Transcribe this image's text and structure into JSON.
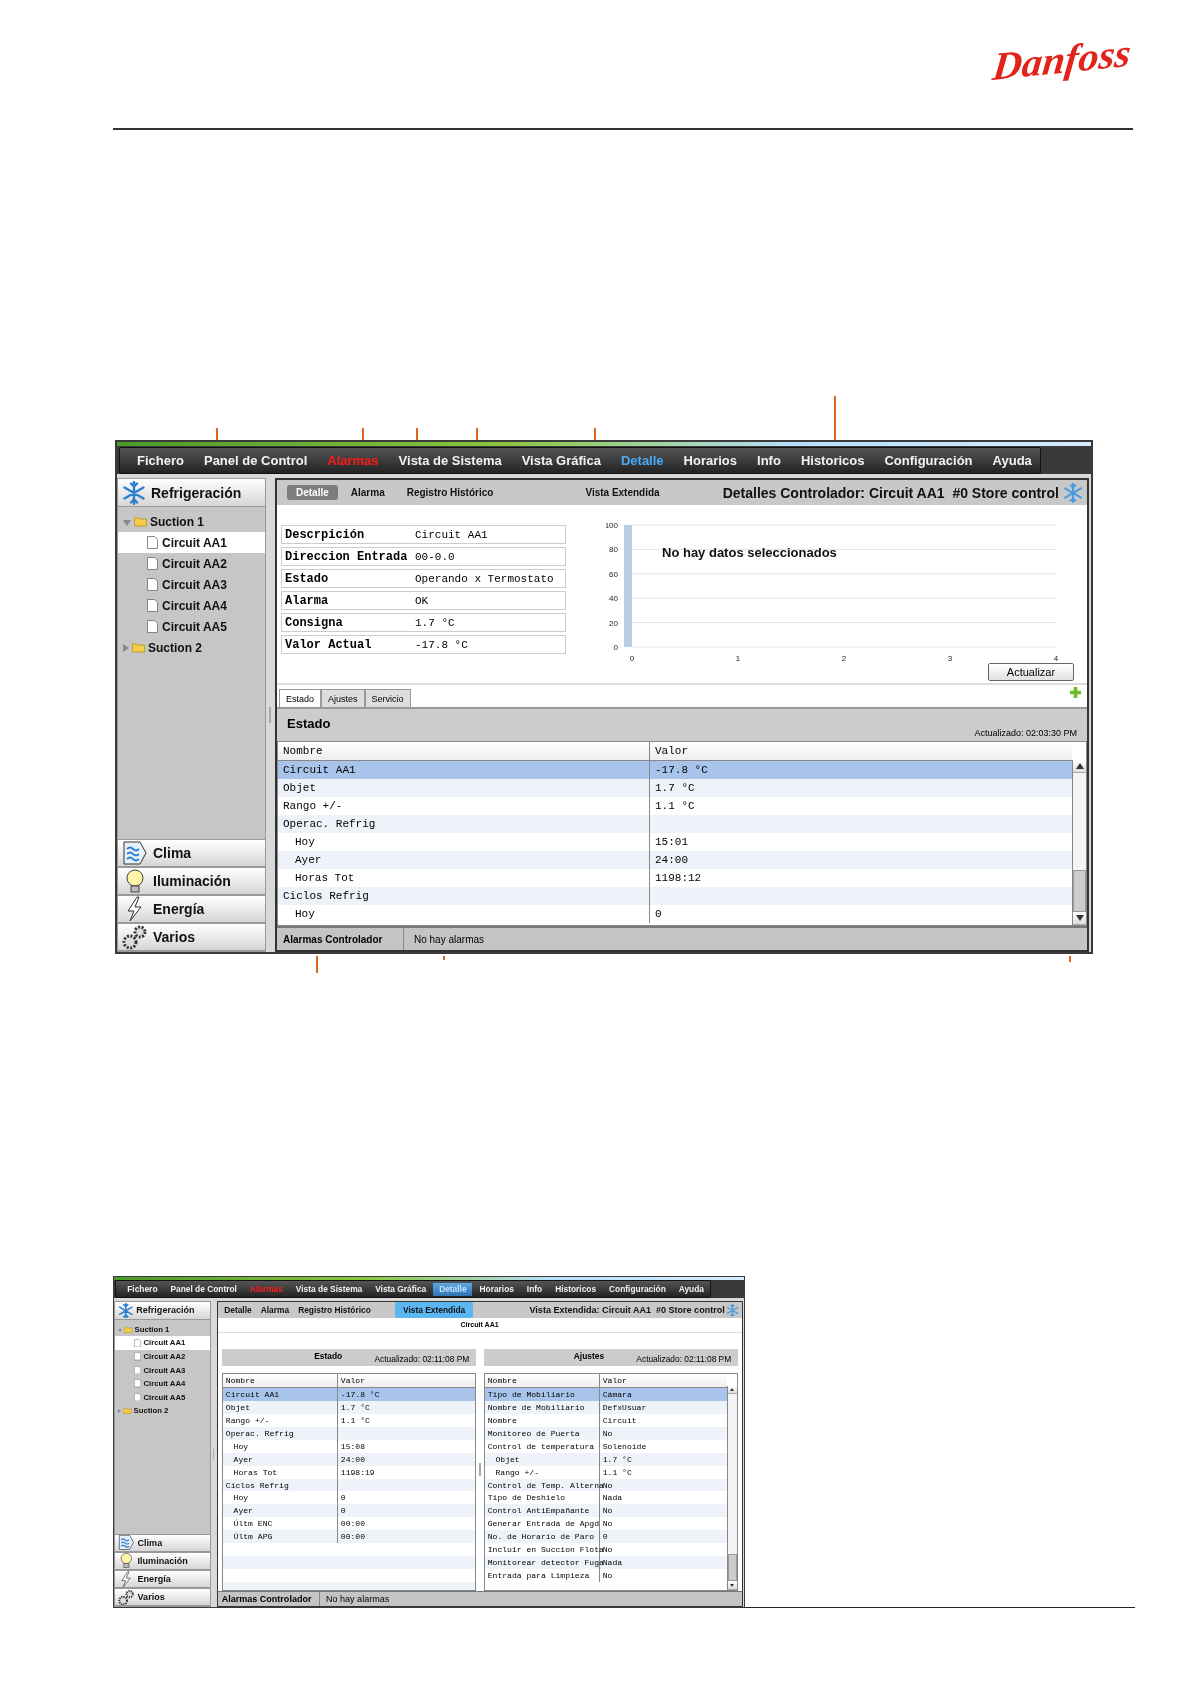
{
  "brand": "Danfoss",
  "screens": [
    {
      "kind": "detail",
      "menu": [
        {
          "label": "Fichero",
          "selected": false,
          "alert": false
        },
        {
          "label": "Panel de Control",
          "selected": false,
          "alert": false
        },
        {
          "label": "Alarmas",
          "selected": false,
          "alert": true
        },
        {
          "label": "Vista de Sistema",
          "selected": false,
          "alert": false
        },
        {
          "label": "Vista Gráfica",
          "selected": false,
          "alert": false
        },
        {
          "label": "Detalle",
          "selected": true,
          "alert": false
        },
        {
          "label": "Horarios",
          "selected": false,
          "alert": false
        },
        {
          "label": "Info",
          "selected": false,
          "alert": false
        },
        {
          "label": "Historicos",
          "selected": false,
          "alert": false
        },
        {
          "label": "Configuración",
          "selected": false,
          "alert": false
        },
        {
          "label": "Ayuda",
          "selected": false,
          "alert": false
        }
      ],
      "sidebar": {
        "title": "Refrigeración",
        "tree": [
          {
            "label": "Suction 1",
            "expanded": true,
            "selected": false,
            "children": [
              {
                "label": "Circuit AA1",
                "selected": true
              },
              {
                "label": "Circuit AA2",
                "selected": false
              },
              {
                "label": "Circuit AA3",
                "selected": false
              },
              {
                "label": "Circuit AA4",
                "selected": false
              },
              {
                "label": "Circuit AA5",
                "selected": false
              }
            ]
          },
          {
            "label": "Suction 2",
            "expanded": false,
            "selected": false
          }
        ],
        "sections": [
          {
            "label": "Clima",
            "kind": "waves"
          },
          {
            "label": "Iluminación",
            "kind": "bulb"
          },
          {
            "label": "Energía",
            "kind": "bolt"
          },
          {
            "label": "Varios",
            "kind": "gears"
          }
        ]
      },
      "subtabs": [
        {
          "label": "Detalle",
          "selected": true
        },
        {
          "label": "Alarma",
          "selected": false
        },
        {
          "label": "Registro Histórico",
          "selected": false
        },
        {
          "label": "Vista Extendida",
          "selected": false
        }
      ],
      "title": "Detalles Controlador: Circuit AA1  #0 Store control",
      "details": [
        {
          "label": "Descrpición",
          "value": "Circuit AA1"
        },
        {
          "label": "Direccion Entrada",
          "value": "00-0.0"
        },
        {
          "label": "Estado",
          "value": "Operando x Termostato"
        },
        {
          "label": "Alarma",
          "value": "OK"
        },
        {
          "label": "Consigna",
          "value": "1.7 °C"
        },
        {
          "label": "Valor Actual",
          "value": "-17.8 °C"
        }
      ],
      "chart": {
        "yticks": [
          "100",
          "80",
          "60",
          "40",
          "20",
          "0"
        ],
        "xticks": [
          "0",
          "1",
          "2",
          "3",
          "4"
        ],
        "message": "No hay datos seleccionados"
      },
      "refresh_button": "Actualizar",
      "tabs": [
        {
          "label": "Estado",
          "selected": true
        },
        {
          "label": "Ajustes",
          "selected": false
        },
        {
          "label": "Servicio",
          "selected": false
        }
      ],
      "panels": [
        {
          "title": "Estado",
          "updated": "Actualizado: 02:03:30 PM",
          "scrollable": true,
          "columns": [
            "Nombre",
            "Valor"
          ],
          "rows": [
            {
              "name": "Circuit AA1",
              "value": "-17.8 °C",
              "selected": true
            },
            {
              "name": "Objet",
              "value": "1.7 °C",
              "selected": false
            },
            {
              "name": "Rango +/-",
              "value": "1.1 °C",
              "selected": false
            },
            {
              "name": "Operac. Refrig",
              "selected": false,
              "children": [
                {
                  "name": "Hoy",
                  "value": "15:01",
                  "selected": false
                },
                {
                  "name": "Ayer",
                  "value": "24:00",
                  "selected": false
                },
                {
                  "name": "Horas Tot",
                  "value": "1198:12",
                  "selected": false
                }
              ]
            },
            {
              "name": "Ciclos Refrig",
              "selected": false,
              "children": [
                {
                  "name": "Hoy",
                  "value": "0",
                  "selected": false
                }
              ]
            }
          ]
        }
      ],
      "status": {
        "label": "Alarmas Controlador",
        "value": "No hay alarmas"
      }
    },
    {
      "kind": "extended",
      "menu": [
        {
          "label": "Fichero",
          "selected": false,
          "alert": false
        },
        {
          "label": "Panel de Control",
          "selected": false,
          "alert": false
        },
        {
          "label": "Alarmas",
          "selected": false,
          "alert": true
        },
        {
          "label": "Vista de Sistema",
          "selected": false,
          "alert": false
        },
        {
          "label": "Vista Gráfica",
          "selected": false,
          "alert": false
        },
        {
          "label": "Detalle",
          "selected": true,
          "alert": false
        },
        {
          "label": "Horarios",
          "selected": false,
          "alert": false
        },
        {
          "label": "Info",
          "selected": false,
          "alert": false
        },
        {
          "label": "Historicos",
          "selected": false,
          "alert": false
        },
        {
          "label": "Configuración",
          "selected": false,
          "alert": false
        },
        {
          "label": "Ayuda",
          "selected": false,
          "alert": false
        }
      ],
      "sidebar": {
        "title": "Refrigeración",
        "tree": [
          {
            "label": "Suction 1",
            "expanded": true,
            "selected": false,
            "children": [
              {
                "label": "Circuit AA1",
                "selected": true
              },
              {
                "label": "Circuit AA2",
                "selected": false
              },
              {
                "label": "Circuit AA3",
                "selected": false
              },
              {
                "label": "Circuit AA4",
                "selected": false
              },
              {
                "label": "Circuit AA5",
                "selected": false
              }
            ]
          },
          {
            "label": "Suction 2",
            "expanded": false,
            "selected": false
          }
        ],
        "sections": [
          {
            "label": "Clima",
            "kind": "waves"
          },
          {
            "label": "Iluminación",
            "kind": "bulb"
          },
          {
            "label": "Energía",
            "kind": "bolt"
          },
          {
            "label": "Varios",
            "kind": "gears"
          }
        ]
      },
      "subtabs": [
        {
          "label": "Detalle",
          "selected": false
        },
        {
          "label": "Alarma",
          "selected": false
        },
        {
          "label": "Registro Histórico",
          "selected": false
        },
        {
          "label": "Vista Extendida",
          "selected": true
        }
      ],
      "title": "Vista Extendida: Circuit AA1  #0 Store control",
      "subtitle": "Circuit AA1",
      "panels": [
        {
          "title": "Estado",
          "updated": "Actualizado: 02:11:08 PM",
          "scrollable": false,
          "columns": [
            "Nombre",
            "Valor"
          ],
          "rows": [
            {
              "name": "Circuit AA1",
              "value": "-17.8 °C",
              "selected": true
            },
            {
              "name": "Objet",
              "value": "1.7 °C",
              "selected": false
            },
            {
              "name": "Rango +/-",
              "value": "1.1 °C",
              "selected": false
            },
            {
              "name": "Operac. Refrig",
              "selected": false,
              "children": [
                {
                  "name": "Hoy",
                  "value": "15:08",
                  "selected": false
                },
                {
                  "name": "Ayer",
                  "value": "24:00",
                  "selected": false
                },
                {
                  "name": "Horas Tot",
                  "value": "1198:19",
                  "selected": false
                }
              ]
            },
            {
              "name": "Ciclos Refrig",
              "selected": false,
              "children": [
                {
                  "name": "Hoy",
                  "value": "0",
                  "selected": false
                },
                {
                  "name": "Ayer",
                  "value": "0",
                  "selected": false
                },
                {
                  "name": "Últm ENC",
                  "value": "00:00",
                  "selected": false
                },
                {
                  "name": "Últm APG",
                  "value": "00:00",
                  "selected": false
                }
              ]
            }
          ]
        },
        {
          "title": "Ajustes",
          "updated": "Actualizado: 02:11:08 PM",
          "scrollable": true,
          "columns": [
            "Nombre",
            "Valor"
          ],
          "rows": [
            {
              "name": "Tipo de Mobiliario",
              "value": "Cámara",
              "selected": true
            },
            {
              "name": "Nombre de Mobiliario",
              "value": "DefxUsuar",
              "selected": false
            },
            {
              "name": "Nombre",
              "value": "Circuit",
              "selected": false
            },
            {
              "name": "Monitoreo de Puerta",
              "value": "No",
              "selected": false
            },
            {
              "name": "Control de temperatura",
              "value": "Solenoide",
              "selected": false,
              "children": [
                {
                  "name": "Objet",
                  "value": "1.7 °C",
                  "selected": false
                },
                {
                  "name": "Rango +/-",
                  "value": "1.1 °C",
                  "selected": false
                }
              ]
            },
            {
              "name": "Control de Temp. Alterna",
              "value": "No",
              "selected": false
            },
            {
              "name": "Tipo de Deshielo",
              "value": "Nada",
              "selected": false
            },
            {
              "name": "Control AntiEmpañante",
              "value": "No",
              "selected": false
            },
            {
              "name": "Generar Entrada de Apgd",
              "value": "No",
              "selected": false
            },
            {
              "name": "No. de Horario de Paro",
              "value": "0",
              "selected": false
            },
            {
              "name": "Incluir en Succion Flota",
              "value": "No",
              "selected": false
            },
            {
              "name": "Monitorear detector Fuga",
              "value": "Nada",
              "selected": false
            },
            {
              "name": "Entrada para Limpieza",
              "value": "No",
              "selected": false
            }
          ]
        }
      ],
      "status": {
        "label": "Alarmas Controlador",
        "value": "No hay alarmas"
      }
    }
  ]
}
